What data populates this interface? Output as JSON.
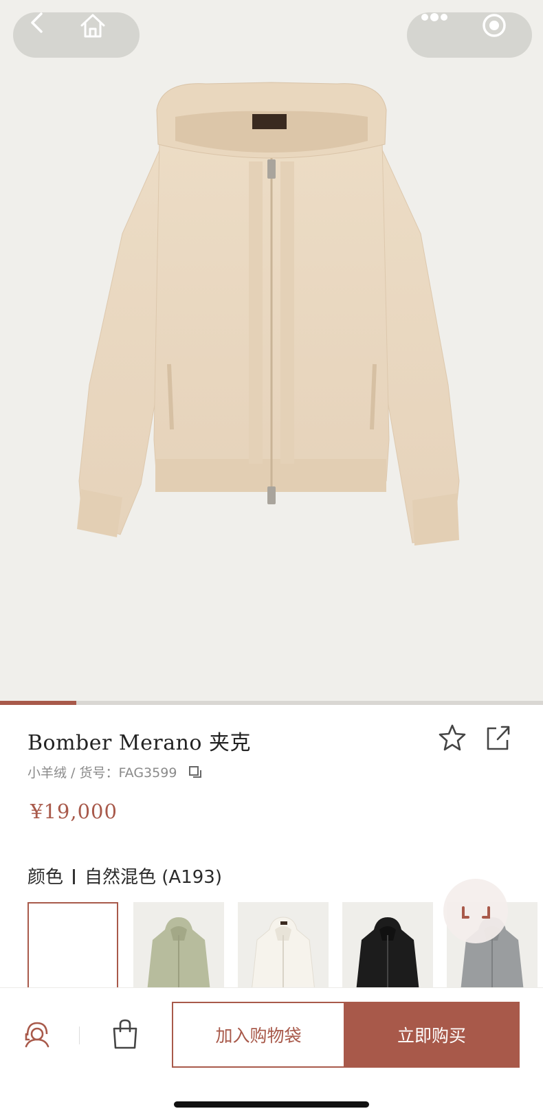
{
  "product": {
    "title": "Bomber Merano 夹克",
    "meta": "小羊绒 / 货号：FAG3599",
    "price": "¥19,000"
  },
  "color": {
    "label": "颜色",
    "selected_name": "自然混色 (A193)"
  },
  "gallery": {
    "progress_fraction": 0.14
  },
  "swatches": [
    {
      "name": "natural",
      "color": "#ffffff",
      "selected": true
    },
    {
      "name": "sage",
      "color": "#b7bc9d"
    },
    {
      "name": "cream",
      "color": "#f4f1ea"
    },
    {
      "name": "black",
      "color": "#1c1c1c"
    },
    {
      "name": "grey",
      "color": "#9a9d9f"
    }
  ],
  "actions": {
    "add_to_bag": "加入购物袋",
    "buy_now": "立即购买"
  },
  "icons": [
    "back-icon",
    "home-icon",
    "more-icon",
    "capsule-close-icon",
    "star-icon",
    "share-icon",
    "copy-icon",
    "customer-service-icon",
    "bag-icon"
  ],
  "colors": {
    "accent": "#a8594a",
    "hero_bg": "#f0efeb",
    "product": "#ead9c2"
  }
}
